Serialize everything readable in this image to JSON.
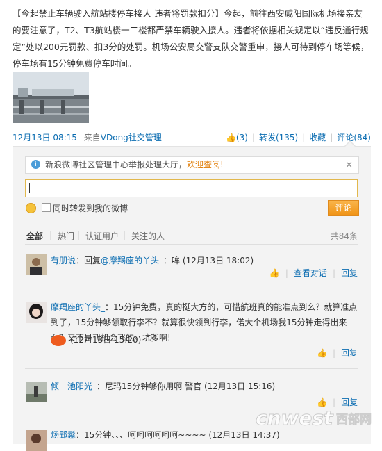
{
  "post": {
    "text_segments": [
      {
        "t": "【今起禁止车辆驶入航站楼停车接人 违者将罚款扣分】今起，前往西安咸阳国际机场接亲友的要注意了，T2、T3航站楼一二楼都严禁车辆驶入接人。违者将依据相关规定以“违反通行规定”处以200元罚款、扣3分的处罚。机场公安局交警支队交警重申，接人可待到停车场等候，停车场有15分钟免费停车时间。"
      }
    ],
    "time": "12月13日 08:15",
    "source_prefix": "来自",
    "source": "VDong社交管理",
    "likes": "(3)",
    "repost": "转发(135)",
    "favorite": "收藏",
    "comment": "评论(84)"
  },
  "notice": {
    "text": "新浪微博社区管理中心举报处理大厅，",
    "link": "欢迎查阅!",
    "close": "×"
  },
  "comment_box": {
    "checkbox_label": "同时转发到我的微博",
    "submit": "评论"
  },
  "tabs": {
    "all": "全部",
    "hot": "热门",
    "verified": "认证用户",
    "following": "关注的人",
    "count": "共84条"
  },
  "comments": [
    {
      "name": "有朋说",
      "text": "：回复",
      "mention": "@摩羯座的丫头_",
      "text2": "：哞",
      "time": "(12月13日 18:02)",
      "view_conv": "查看对话",
      "reply": "回复"
    },
    {
      "name": "摩羯座的丫头_",
      "text": "：15分钟免费，真的挺大方的，可惜航班真的能准点到么？就算准点到了，15分钟够领取行李不？就算很快领到行李，偌大个机场我15分钟走得出来么？又不是飞机会飞的。坑爹啊!",
      "time": "(12月13日 15:20)",
      "reply": "回复"
    },
    {
      "name": "倾一池阳光_",
      "text": "：尼玛15分钟够你用啊 警官",
      "time": "(12月13日 15:16)",
      "reply": "回复"
    },
    {
      "name": "炀郢鬈",
      "text": "：15分钟、、、呵呵呵呵呵呵~~~~",
      "time": "(12月13日 14:37)"
    }
  ],
  "watermark": {
    "text": "cnwest",
    "cn": "西部网"
  },
  "colors": {
    "link": "#0a6cb1",
    "accent": "#f09315"
  }
}
